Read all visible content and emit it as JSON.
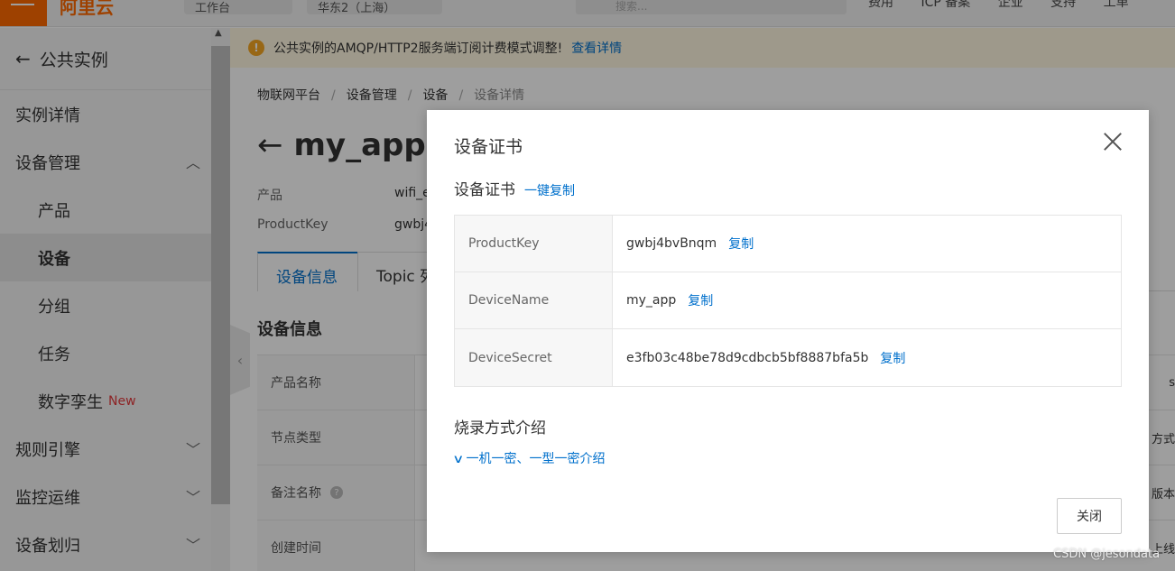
{
  "topbar": {
    "logo": "阿里云",
    "workbench": "工作台",
    "region": "华东2（上海）",
    "search_placeholder": "搜索...",
    "links": [
      "费用",
      "ICP 备案",
      "企业",
      "支持",
      "工单"
    ]
  },
  "sidebar": {
    "back_label": "公共实例",
    "items": [
      {
        "label": "实例详情"
      },
      {
        "label": "设备管理"
      },
      {
        "label": "产品"
      },
      {
        "label": "设备"
      },
      {
        "label": "分组"
      },
      {
        "label": "任务"
      },
      {
        "label": "数字孪生",
        "badge": "New"
      },
      {
        "label": "规则引擎"
      },
      {
        "label": "监控运维"
      },
      {
        "label": "设备划归"
      }
    ]
  },
  "notice": {
    "text": "公共实例的AMQP/HTTP2服务端订阅计费模式调整!",
    "link": "查看详情"
  },
  "breadcrumb": [
    "物联网平台",
    "设备管理",
    "设备",
    "设备详情"
  ],
  "page": {
    "title": "my_app",
    "meta": [
      {
        "label": "产品",
        "value": "wifi_e"
      },
      {
        "label": "ProductKey",
        "value": "gwbj4"
      }
    ],
    "tabs": [
      "设备信息",
      "Topic 列"
    ],
    "section_title": "设备信息",
    "info_rows": [
      {
        "label": "产品名称",
        "right": "s"
      },
      {
        "label": "节点类型",
        "right": "方式"
      },
      {
        "label": "备注名称",
        "right": "版本"
      },
      {
        "label": "创建时间",
        "right": "上线"
      }
    ]
  },
  "modal": {
    "title": "设备证书",
    "subtitle": "设备证书",
    "copy_all": "一键复制",
    "rows": [
      {
        "key": "ProductKey",
        "value": "gwbj4bvBnqm",
        "copy": "复制"
      },
      {
        "key": "DeviceName",
        "value": "my_app",
        "copy": "复制"
      },
      {
        "key": "DeviceSecret",
        "value": "e3fb03c48be78d9cdbcb5bf8887bfa5b",
        "copy": "复制"
      }
    ],
    "burn_title": "烧录方式介绍",
    "intro_link": "一机一密、一型一密介绍",
    "close_button": "关闭"
  },
  "watermark": "CSDN @jesondata",
  "colors": {
    "accent": "#0070cc",
    "brand": "#ff6a00",
    "new_badge": "#e4393c"
  }
}
